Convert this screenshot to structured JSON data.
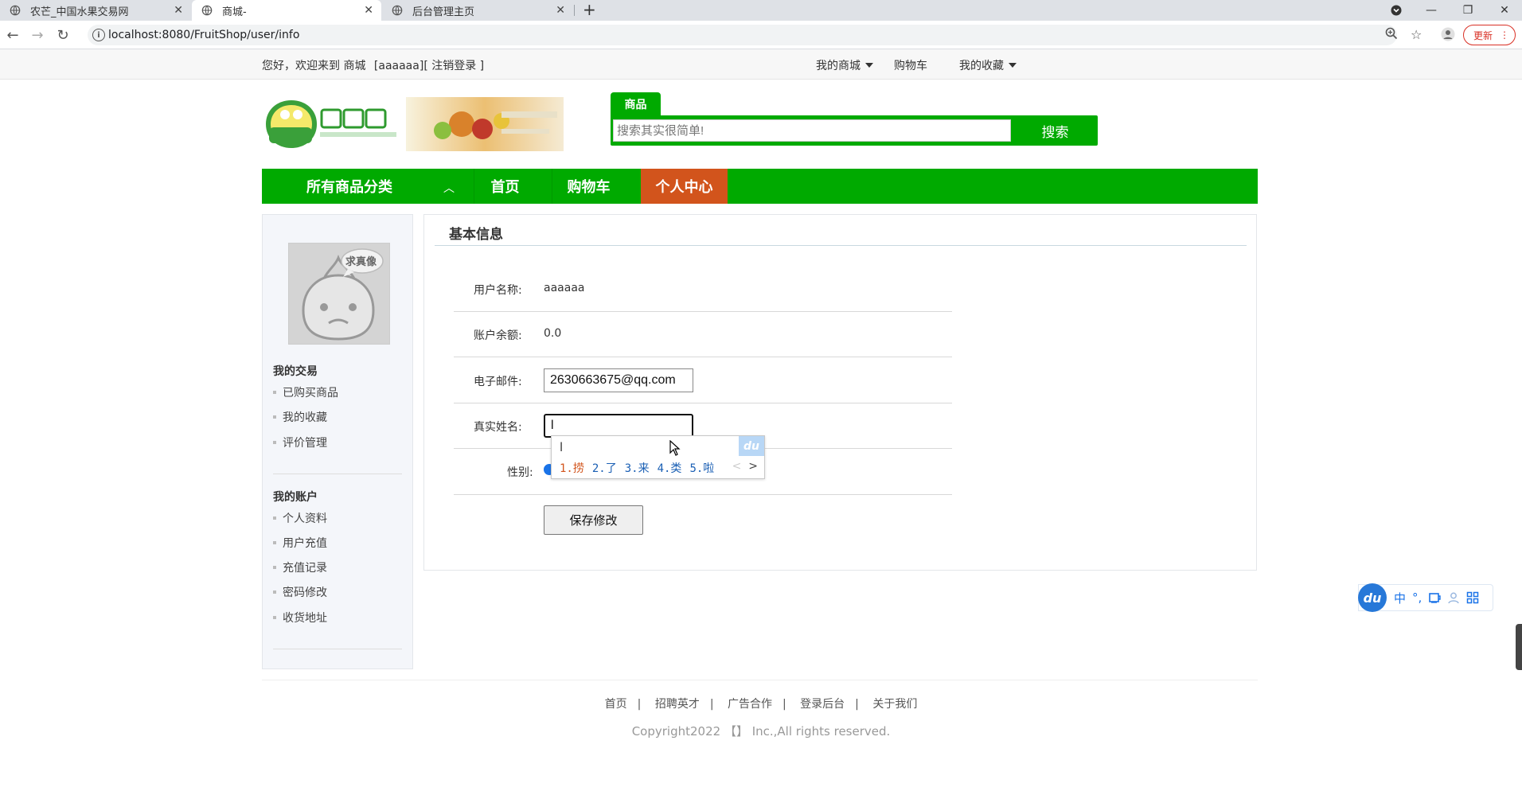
{
  "browser": {
    "tabs": [
      {
        "title": "农芒_中国水果交易网"
      },
      {
        "title": "商城-"
      },
      {
        "title": "后台管理主页"
      }
    ],
    "url": "localhost:8080/FruitShop/user/info",
    "update_label": "更新"
  },
  "site": {
    "welcome": "您好，欢迎来到 商城",
    "user_tag": "[aaaaaa]",
    "logout": "[ 注销登录 ]",
    "top_nav": {
      "my_mall": "我的商城",
      "cart": "购物车",
      "favorites": "我的收藏"
    }
  },
  "search": {
    "tab_label": "商品",
    "placeholder": "搜索其实很简单!",
    "button_label": "搜索"
  },
  "main_nav": {
    "categories": "所有商品分类",
    "home": "首页",
    "cart": "购物车",
    "profile_center": "个人中心"
  },
  "sidebar": {
    "avatar_badge": "求真像",
    "trade_heading": "我的交易",
    "trade_items": [
      "已购买商品",
      "我的收藏",
      "评价管理"
    ],
    "account_heading": "我的账户",
    "account_items": [
      "个人资料",
      "用户充值",
      "充值记录",
      "密码修改",
      "收货地址"
    ]
  },
  "info": {
    "title": "基本信息",
    "username_label": "用户名称:",
    "username_value": "aaaaaa",
    "balance_label": "账户余额:",
    "balance_value": "0.0",
    "email_label": "电子邮件:",
    "email_value": "2630663675@qq.com",
    "realname_label": "真实姓名:",
    "realname_value": "l",
    "gender_label": "性别:",
    "save_label": "保存修改"
  },
  "ime_popup": {
    "composition": "l",
    "candidates": [
      "1.捞",
      "2.了",
      "3.来",
      "4.类",
      "5.啦"
    ],
    "logo": "du"
  },
  "footer": {
    "links": [
      "首页",
      "招聘英才",
      "广告合作",
      "登录后台",
      "关于我们"
    ],
    "copyright": "Copyright2022 【】 Inc.,All rights reserved."
  },
  "ime_bar": {
    "logo": "du",
    "mode": "中",
    "punct": "°,"
  },
  "colors": {
    "brand_green": "#00aa00",
    "active_orange": "#d2541c"
  }
}
